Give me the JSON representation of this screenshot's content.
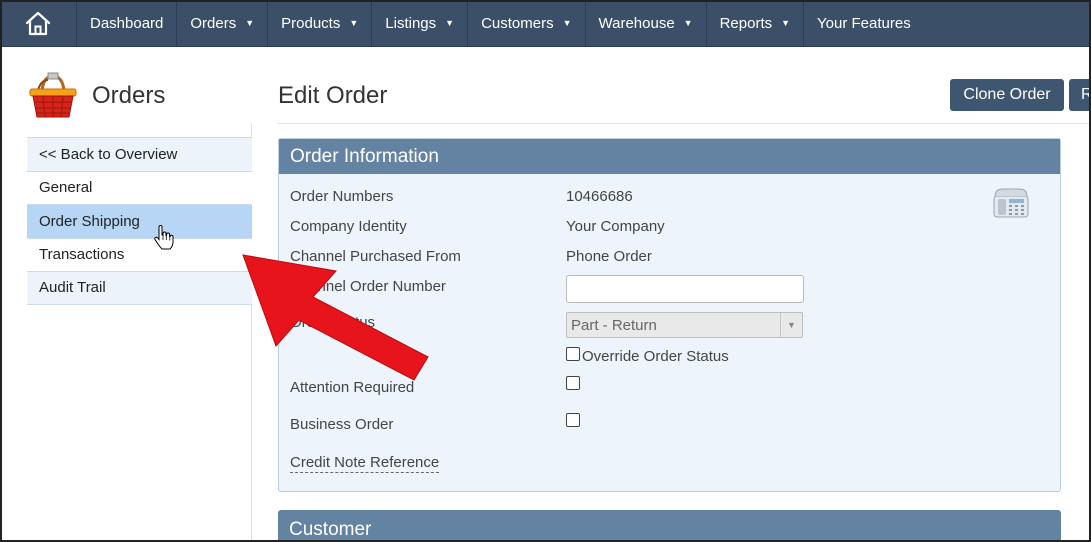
{
  "nav": {
    "items": [
      {
        "label": "Dashboard",
        "has_caret": false
      },
      {
        "label": "Orders",
        "has_caret": true
      },
      {
        "label": "Products",
        "has_caret": true
      },
      {
        "label": "Listings",
        "has_caret": true
      },
      {
        "label": "Customers",
        "has_caret": true
      },
      {
        "label": "Warehouse",
        "has_caret": true
      },
      {
        "label": "Reports",
        "has_caret": true
      },
      {
        "label": "Your Features",
        "has_caret": false
      }
    ],
    "caret_glyph": "▼"
  },
  "sidebar": {
    "title": "Orders",
    "items": [
      {
        "label": "<< Back to Overview",
        "state": "light"
      },
      {
        "label": "General",
        "state": "plain"
      },
      {
        "label": "Order Shipping",
        "state": "active"
      },
      {
        "label": "Transactions",
        "state": "plain"
      },
      {
        "label": "Audit Trail",
        "state": "light"
      }
    ]
  },
  "main": {
    "page_title": "Edit Order",
    "buttons": {
      "clone": "Clone Order",
      "second": "R"
    },
    "order_info": {
      "heading": "Order Information",
      "order_numbers_label": "Order Numbers",
      "order_numbers_value": "10466686",
      "company_label": "Company Identity",
      "company_value": "Your Company",
      "channel_label": "Channel Purchased From",
      "channel_value": "Phone Order",
      "channel_order_number_label": "Channel Order Number",
      "channel_order_number_value": "",
      "order_status_label": "Order Status",
      "order_status_value": "Part - Return",
      "override_label": "Override Order Status",
      "override_checked": false,
      "attention_label": "Attention Required",
      "attention_checked": false,
      "business_label": "Business Order",
      "business_checked": false,
      "credit_note_label": "Credit Note Reference"
    },
    "customer_heading": "Customer"
  },
  "colors": {
    "nav_bg": "#3b4f68",
    "panel_header": "#6483a2",
    "panel_bg": "#eef4fb",
    "sidebar_active": "#b7d6f6",
    "arrow": "#e8141b"
  },
  "icons": [
    "home-icon",
    "basket-icon",
    "phone-icon",
    "hand-cursor-icon",
    "red-arrow"
  ]
}
